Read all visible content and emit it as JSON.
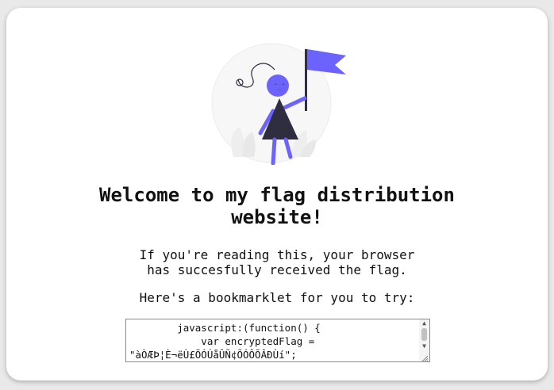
{
  "page": {
    "title_line1": "Welcome to my flag distribution",
    "title_line2": "website!",
    "message_line1": "If you're reading this, your browser",
    "message_line2": "has succesfully received the flag.",
    "bookmarklet_prompt": "Here's a bookmarklet for you to try:"
  },
  "bookmarklet": {
    "code": "        javascript:(function() {\n            var encryptedFlag =\n\"àÒÆÞ¦È¬ëÙ£ÖÓÚåÛÑ¢ÕÓÔÕÂÐÙí\";"
  },
  "illustration": {
    "icon": "person-with-flag-illustration",
    "accent_color": "#6c63ff",
    "dark_color": "#2f2e41"
  }
}
